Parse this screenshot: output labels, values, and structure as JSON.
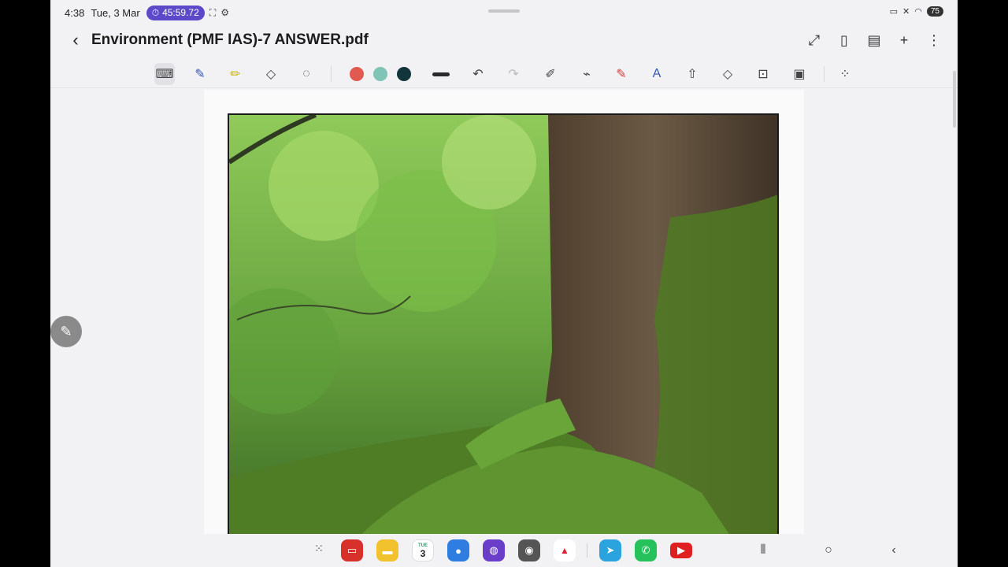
{
  "status_bar": {
    "time": "4:38",
    "date": "Tue, 3 Mar",
    "timer": "45:59.72",
    "battery": "75"
  },
  "title_bar": {
    "title": "Environment (PMF IAS)-7 ANSWER.pdf"
  },
  "toolbar": {
    "tools": [
      "keyboard-icon",
      "pen-icon",
      "highlighter-icon",
      "eraser-icon",
      "lasso-icon"
    ],
    "colors": [
      "#e05a50",
      "#7fc4b5",
      "#12343b"
    ],
    "actions": [
      "undo-icon",
      "redo-icon"
    ]
  },
  "taskbar": {
    "calendar_day": "3",
    "calendar_weekday": "TUE"
  },
  "colors": {
    "timer_pill": "#5b49c9",
    "background": "#f2f2f4"
  }
}
